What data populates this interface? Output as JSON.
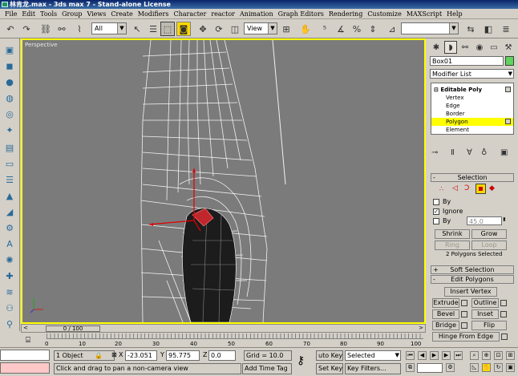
{
  "window": {
    "title": "林肯龙.max - 3ds max 7 - Stand-alone License"
  },
  "menu": [
    "File",
    "Edit",
    "Tools",
    "Group",
    "Views",
    "Create",
    "Modifiers",
    "Character",
    "reactor",
    "Animation",
    "Graph Editors",
    "Rendering",
    "Customize",
    "MAXScript",
    "Help"
  ],
  "toolbar": {
    "selection_filter": "All",
    "reference_coord": "View"
  },
  "viewport": {
    "label": "Perspective"
  },
  "panel": {
    "object_name": "Box01",
    "object_color": "#5fd35f",
    "modifier_list": "Modifier List",
    "stack": [
      {
        "label": "Editable Poly",
        "level": 0
      },
      {
        "label": "Vertex",
        "level": 1
      },
      {
        "label": "Edge",
        "level": 1
      },
      {
        "label": "Border",
        "level": 1
      },
      {
        "label": "Polygon",
        "level": 1
      },
      {
        "label": "Element",
        "level": 1
      }
    ],
    "selection_title": "Selection",
    "by_vertex_label": "By",
    "ignore_label": "Ignore",
    "by_angle_label": "By",
    "angle_value": "45.0",
    "shrink": "Shrink",
    "grow": "Grow",
    "ring": "Ring",
    "loop": "Loop",
    "selection_status": "2 Polygons Selected",
    "soft_selection": "Soft Selection",
    "edit_polygons": "Edit Polygons",
    "insert_vertex": "Insert Vertex",
    "extrude": "Extrude",
    "outline": "Outline",
    "bevel": "Bevel",
    "inset": "Inset",
    "bridge": "Bridge",
    "flip": "Flip",
    "hinge": "Hinge From Edge"
  },
  "timeline": {
    "slider": "0 / 100",
    "ticks": [
      "0",
      "10",
      "20",
      "30",
      "40",
      "50",
      "60",
      "70",
      "80",
      "90",
      "100"
    ]
  },
  "status": {
    "selection": "1 Object",
    "x_label": "X",
    "x_value": "-23.051",
    "y_label": "Y",
    "y_value": "95.775",
    "z_label": "Z",
    "z_value": "0.0",
    "grid": "Grid = 10.0",
    "auto_key": "uto Key",
    "selected": "Selected",
    "set_key": "Set Key",
    "key_filters": "Key Filters...",
    "add_time_tag": "Add Time Tag",
    "prompt": "Click and drag to pan a non-camera view"
  }
}
